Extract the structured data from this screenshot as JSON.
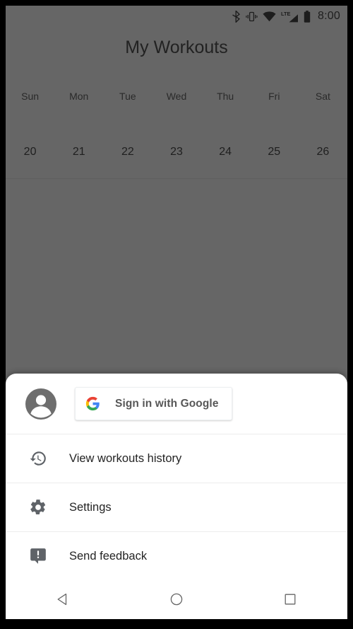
{
  "status_bar": {
    "icons": [
      "bluetooth-icon",
      "vibrate-icon",
      "wifi-icon",
      "lte-signal-icon",
      "battery-icon"
    ],
    "network_label": "LTE",
    "clock": "8:00"
  },
  "app": {
    "title": "My Workouts",
    "weekdays": [
      "Sun",
      "Mon",
      "Tue",
      "Wed",
      "Thu",
      "Fri",
      "Sat"
    ],
    "dates": [
      "20",
      "21",
      "22",
      "23",
      "24",
      "25",
      "26"
    ]
  },
  "bottom_sheet": {
    "account": {
      "avatar_icon": "account-circle-icon",
      "signin_button": {
        "icon": "google-g-icon",
        "label": "Sign in with Google"
      }
    },
    "menu_items": [
      {
        "icon": "history-icon",
        "label": "View workouts history"
      },
      {
        "icon": "gear-icon",
        "label": "Settings"
      },
      {
        "icon": "feedback-icon",
        "label": "Send feedback"
      }
    ]
  },
  "nav_bar": {
    "buttons": [
      {
        "icon": "back-triangle-icon",
        "label": "Back"
      },
      {
        "icon": "home-circle-icon",
        "label": "Home"
      },
      {
        "icon": "recents-square-icon",
        "label": "Recents"
      }
    ]
  },
  "colors": {
    "scrim": "#666666",
    "sheet_background": "#ffffff",
    "divider": "#ececec",
    "icon_gray": "#5f6368",
    "google_blue": "#4285F4",
    "google_red": "#EA4335",
    "google_yellow": "#FBBC05",
    "google_green": "#34A853"
  }
}
